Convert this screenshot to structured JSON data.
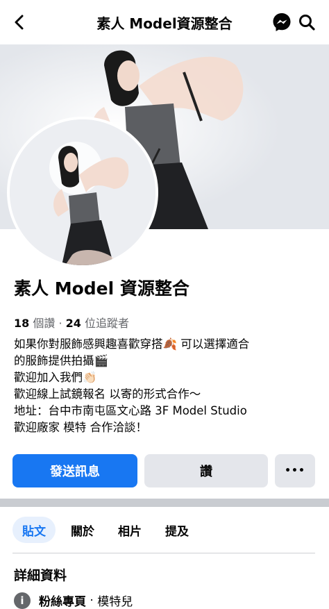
{
  "header": {
    "title": "素人 Model資源整合"
  },
  "icons": {
    "back": "back-arrow-icon",
    "messenger": "messenger-icon",
    "search": "search-icon"
  },
  "page": {
    "name": "素人 Model 資源整合",
    "likes_count": "18",
    "likes_label": "個讚",
    "followers_count": "24",
    "followers_label": "位追蹤者",
    "bio": [
      "如果你對服飾感興趣喜歡穿搭🍂 可以選擇適合",
      "的服飾提供拍攝🎬",
      "歡迎加入我們👏🏻",
      "歡迎線上試鏡報名 以寄的形式合作～",
      "地址：台中市南屯區文心路 3F Model Studio",
      "歡迎廠家 模特 合作洽談！"
    ]
  },
  "actions": {
    "message": "發送訊息",
    "like": "讚",
    "more": "•••"
  },
  "tabs": [
    "貼文",
    "關於",
    "相片",
    "提及"
  ],
  "details": {
    "title": "詳細資料",
    "category_label": "粉絲專頁",
    "category_value": "模特兒"
  },
  "colors": {
    "brand": "#1877f2",
    "secondary_button": "#e4e6eb"
  }
}
